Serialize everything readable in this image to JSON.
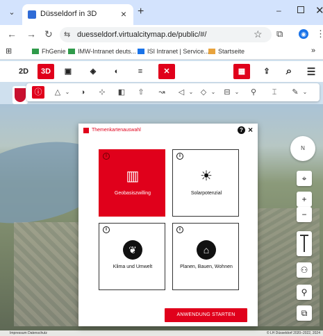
{
  "browser": {
    "tab_title": "Düsseldorf in 3D",
    "tab_menu": "⌄",
    "tab_close": "×",
    "new_tab": "+",
    "window_minimize": "–",
    "window_close": "✕",
    "nav": {
      "back": "←",
      "forward": "→",
      "reload": "↻"
    },
    "site_info_icon": "⇆",
    "url": "duesseldorf.virtualcitymap.de/public/#/",
    "bookmark_star": "☆",
    "extensions_icon": "⧉",
    "profile_initial": "◉",
    "menu_icon": "⋮",
    "bookmarks_overflow": "»",
    "bookmarks": [
      {
        "label": "FhGenie",
        "color": "#2f9a4a"
      },
      {
        "label": "IMW-Intranet deuts...",
        "color": "#2f9a4a"
      },
      {
        "label": "ISI Intranet | Service...",
        "color": "#1a73e8"
      },
      {
        "label": "Startseite",
        "color": "#e8a33d"
      }
    ],
    "apps_icon": "⊞"
  },
  "app_toolbar": {
    "btn_2d": "2D",
    "btn_3d": "3D",
    "icons": {
      "image": "▣",
      "layers": "◈",
      "compare": "◐",
      "filter": "≡",
      "tools": "✕",
      "themes": "▦",
      "share": "⇪",
      "search": "⌕",
      "menu": "☰"
    }
  },
  "tool_row": {
    "icons": {
      "info": "ⓘ",
      "draw": "△",
      "shadow": "◑",
      "measure": "⊹",
      "split": "◧",
      "upload": "⇧",
      "flight": "↝",
      "viewshed": "◁",
      "visibility": "◇",
      "profile": "⊟",
      "marker": "⚲",
      "building": "⌶",
      "pen": "✎",
      "caret": "⌄"
    }
  },
  "map_controls": {
    "compass_label": "N",
    "locate": "⌖",
    "zoom_in": "+",
    "zoom_out": "−",
    "tilt_label": "",
    "walk": "⚇",
    "poi": "⚲",
    "layers": "⧉"
  },
  "footer": {
    "left": "Impressum   Datenschutz",
    "right": "© LH Düsseldorf 2020–2022, 2024"
  },
  "modal": {
    "title": "Themenkartenauswahl",
    "help": "?",
    "close": "×",
    "info_glyph": "i",
    "cards": [
      {
        "label": "Geobasiszwilling",
        "icon": "▥",
        "active": true
      },
      {
        "label": "Solarpotenzial",
        "icon": "☀",
        "active": false
      },
      {
        "label": "Klima und Umwelt",
        "icon": "❦",
        "active": false
      },
      {
        "label": "Planen, Bauen, Wohnen",
        "icon": "⌂",
        "active": false
      }
    ],
    "start_button": "ANWENDUNG STARTEN"
  }
}
